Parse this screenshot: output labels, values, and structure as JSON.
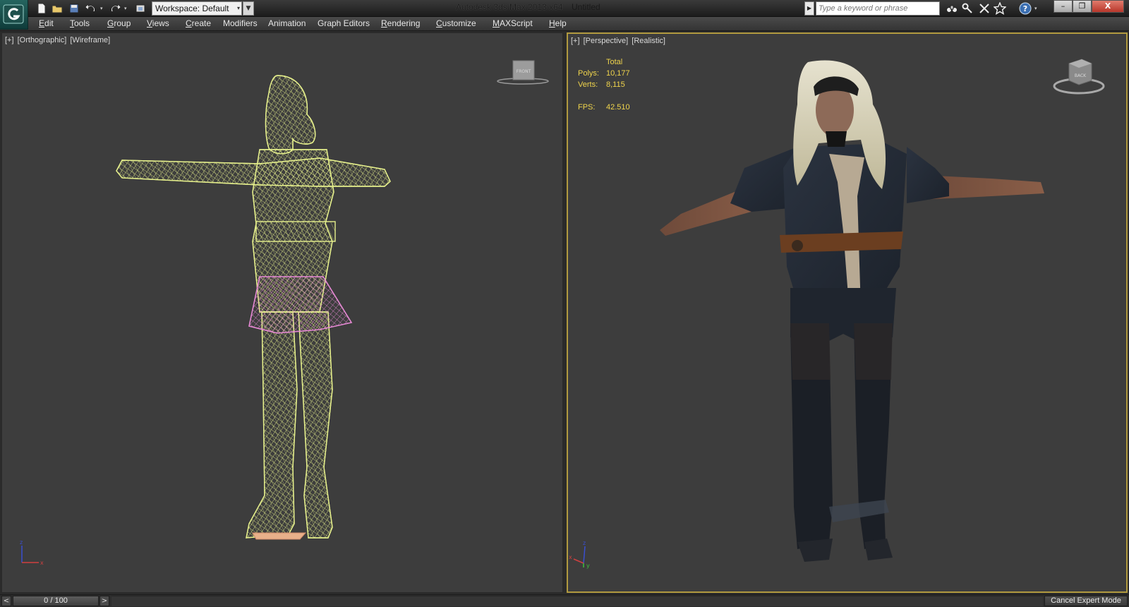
{
  "titlebar": {
    "app_name": "Autodesk 3ds Max  2013 x64",
    "document": "Untitled",
    "workspace_label": "Workspace: Default",
    "search_placeholder": "Type a keyword or phrase",
    "quick_access_icons": [
      "new-file-icon",
      "open-file-icon",
      "save-icon",
      "undo-icon",
      "redo-icon",
      "project-folder-icon"
    ],
    "info_icons": [
      "binoculars-icon",
      "key-tools-icon",
      "favorites-star-icon",
      "help-icon"
    ],
    "window_buttons": {
      "minimize": "–",
      "restore": "❐",
      "close": "X"
    }
  },
  "menu": {
    "items": [
      "Edit",
      "Tools",
      "Group",
      "Views",
      "Create",
      "Modifiers",
      "Animation",
      "Graph Editors",
      "Rendering",
      "Customize",
      "MAXScript",
      "Help"
    ]
  },
  "viewports": {
    "left": {
      "labels": [
        "[+]",
        "[Orthographic]",
        "[Wireframe]"
      ],
      "viewcube_face": "FRONT",
      "wire_color": "#e6f08c",
      "skirt_color": "#e88ad6"
    },
    "right": {
      "labels": [
        "[+]",
        "[Perspective]",
        "[Realistic]"
      ],
      "viewcube_face": "BACK",
      "stats": {
        "header": "Total",
        "polys_label": "Polys:",
        "polys_value": "10,177",
        "verts_label": "Verts:",
        "verts_value": "8,115",
        "fps_label": "FPS:",
        "fps_value": "42.510"
      },
      "active_border_color": "#b19a3f"
    },
    "axis_labels": {
      "x": "x",
      "y": "y",
      "z": "z"
    }
  },
  "timeline": {
    "prev": "<",
    "next": ">",
    "frame_display": "0 / 100",
    "frame_progress": 0
  },
  "expert_mode": {
    "cancel_label": "Cancel Expert Mode"
  }
}
